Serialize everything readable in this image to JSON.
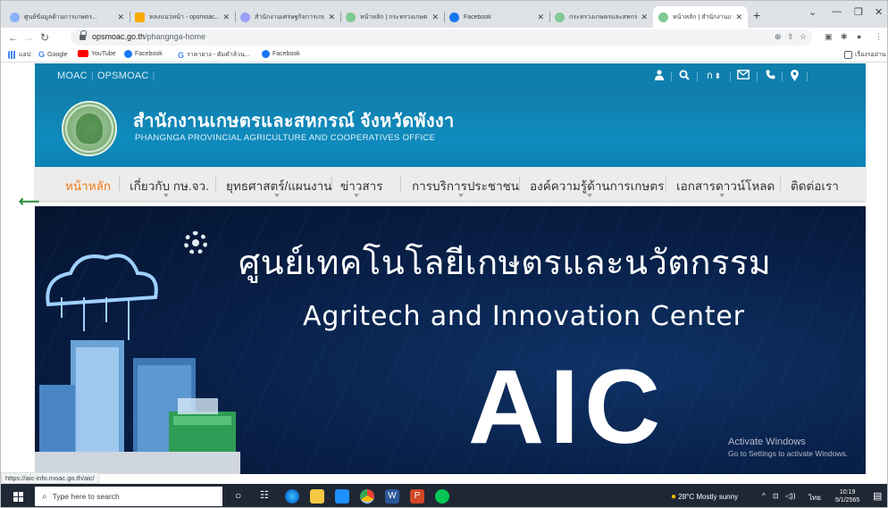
{
  "browser": {
    "tabs": [
      {
        "label": "ศูนย์ข้อมูลด้านการเกษตร...",
        "color": "#8ab4f8"
      },
      {
        "label": "หลงแนวหน้า - opsmoac...",
        "color": "#f9ab00"
      },
      {
        "label": "สำนักงานเศรษฐกิจการเกษ...",
        "color": "#9aa0f5"
      },
      {
        "label": "หน้าหลัก | กระทรวงเกษตร...",
        "color": "#81c995"
      },
      {
        "label": "Facebook",
        "color": "#1877f2"
      },
      {
        "label": "กระทรวงเกษตรและสหกรณ์",
        "color": "#81c995"
      },
      {
        "label": "หน้าหลัก | สำนักงานเกษตร",
        "color": "#81c995"
      }
    ],
    "url_domain": "opsmoac.go.th",
    "url_path": "/phangnga-home",
    "bookmarks": [
      {
        "label": "แอป",
        "icon": "apps-grid-icon",
        "color": "#4285f4"
      },
      {
        "label": "Google",
        "icon": "google-icon",
        "color": "#4285f4"
      },
      {
        "label": "YouTube",
        "icon": "youtube-icon",
        "color": "#ff0000"
      },
      {
        "label": "Facebook",
        "icon": "facebook-icon",
        "color": "#1877f2"
      },
      {
        "label": "ราคายาง - ตัมคำล้วน...",
        "icon": "google-icon",
        "color": "#4285f4"
      },
      {
        "label": "Facebook",
        "icon": "facebook-icon",
        "color": "#1877f2"
      }
    ],
    "reading_list": "เรื่องรออ่าน"
  },
  "site": {
    "top_links": [
      "MOAC",
      "OPSMOAC"
    ],
    "lang_label": "ก",
    "title": "สำนักงานเกษตรและสหกรณ์ จังหวัดพังงา",
    "subtitle": "PHANGNGA PROVINCIAL AGRICULTURE AND COOPERATIVES OFFICE",
    "menu": [
      "หน้าหลัก",
      "เกี่ยวกับ กษ.จว.",
      "ยุทธศาสตร์/แผนงาน",
      "ข่าวสาร",
      "การบริการประชาชน",
      "องค์ความรู้ด้านการเกษตร",
      "เอกสารดาวน์โหลด",
      "ติดต่อเรา"
    ],
    "banner": {
      "thai": "ศูนย์เทคโนโลยีเกษตรและนวัตกรรม",
      "english": "Agritech and Innovation Center",
      "logo": "AIC"
    },
    "colors": {
      "topbar": "#0f7fae",
      "menu_active": "#f07a14"
    }
  },
  "activate_windows": {
    "title": "Activate Windows",
    "subtitle": "Go to Settings to activate Windows."
  },
  "status_url": "https://aic-info.moac.go.th/aic/",
  "taskbar": {
    "search_placeholder": "Type here to search",
    "weather": "28°C  Mostly sunny",
    "lang": "ไทย",
    "time": "10:19",
    "date": "5/1/2565"
  }
}
